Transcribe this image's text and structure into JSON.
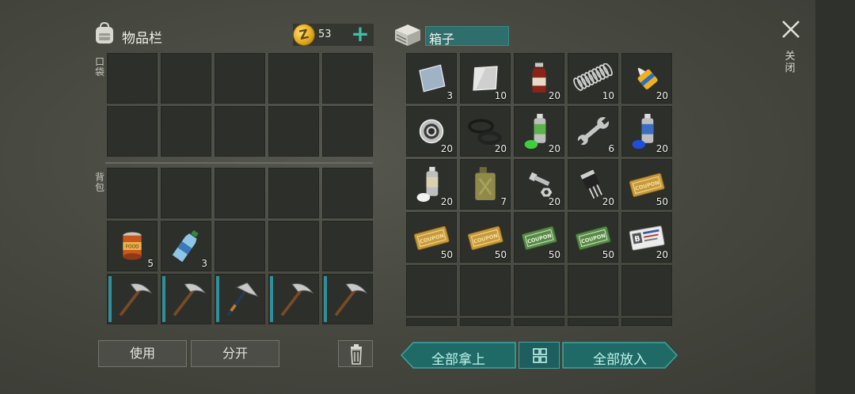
{
  "inventory": {
    "title": "物品栏",
    "coin_symbol": "Z",
    "coins": "53",
    "pocket_label": "口袋",
    "backpack_label": "背包",
    "pocket_slots": [
      {
        "item": "",
        "count": ""
      },
      {
        "item": "",
        "count": ""
      },
      {
        "item": "",
        "count": ""
      },
      {
        "item": "",
        "count": ""
      },
      {
        "item": "",
        "count": ""
      },
      {
        "item": "",
        "count": ""
      },
      {
        "item": "",
        "count": ""
      },
      {
        "item": "",
        "count": ""
      },
      {
        "item": "",
        "count": ""
      },
      {
        "item": "",
        "count": ""
      }
    ],
    "backpack_slots": [
      {
        "item": "",
        "count": ""
      },
      {
        "item": "",
        "count": ""
      },
      {
        "item": "",
        "count": ""
      },
      {
        "item": "",
        "count": ""
      },
      {
        "item": "",
        "count": ""
      },
      {
        "item": "food-can",
        "count": "5"
      },
      {
        "item": "water-bottle",
        "count": "3"
      },
      {
        "item": "",
        "count": ""
      },
      {
        "item": "",
        "count": ""
      },
      {
        "item": "",
        "count": ""
      },
      {
        "item": "pickaxe",
        "count": ""
      },
      {
        "item": "pickaxe",
        "count": ""
      },
      {
        "item": "hatchet-pick",
        "count": ""
      },
      {
        "item": "pickaxe",
        "count": ""
      },
      {
        "item": "pickaxe",
        "count": ""
      }
    ],
    "use_label": "使用",
    "split_label": "分开"
  },
  "container": {
    "title": "箱子",
    "slots": [
      {
        "item": "metal-plate-blue",
        "count": "3"
      },
      {
        "item": "metal-plate-silver",
        "count": "10"
      },
      {
        "item": "medicine-bottle",
        "count": "20"
      },
      {
        "item": "spring",
        "count": "10"
      },
      {
        "item": "glue-tube",
        "count": "20"
      },
      {
        "item": "bearing",
        "count": "20"
      },
      {
        "item": "rubber-rings",
        "count": "20"
      },
      {
        "item": "spray-can-green",
        "count": "20"
      },
      {
        "item": "wrench",
        "count": "6"
      },
      {
        "item": "spray-can-blue",
        "count": "20"
      },
      {
        "item": "spray-can-white",
        "count": "20"
      },
      {
        "item": "jerrycan",
        "count": "7"
      },
      {
        "item": "bolt-nut",
        "count": "20"
      },
      {
        "item": "transistor",
        "count": "20"
      },
      {
        "item": "coupon-orange",
        "count": "50"
      },
      {
        "item": "coupon-orange",
        "count": "50"
      },
      {
        "item": "coupon-orange",
        "count": "50"
      },
      {
        "item": "coupon-green",
        "count": "50"
      },
      {
        "item": "coupon-green",
        "count": "50"
      },
      {
        "item": "army-card",
        "count": "20"
      },
      {
        "item": "",
        "count": ""
      },
      {
        "item": "",
        "count": ""
      },
      {
        "item": "",
        "count": ""
      },
      {
        "item": "",
        "count": ""
      },
      {
        "item": "",
        "count": ""
      }
    ],
    "take_all_label": "全部拿上",
    "put_all_label": "全部放入"
  },
  "close_label": "关闭",
  "colors": {
    "accent": "#3cc0a6",
    "teal_button": "#1f6a66",
    "slot": "#2d2f2a"
  }
}
